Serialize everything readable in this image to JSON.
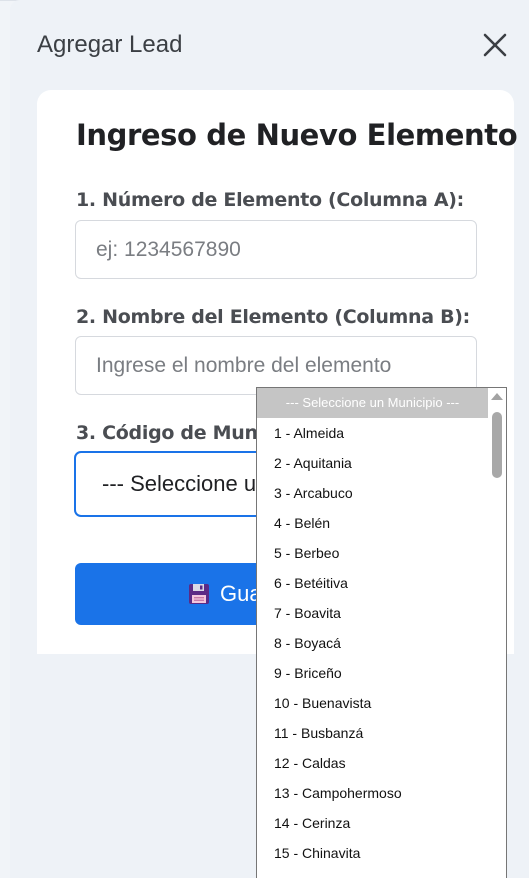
{
  "dialog": {
    "title": "Agregar Lead",
    "close_icon": "close-icon"
  },
  "form": {
    "heading": "Ingreso de Nuevo Elemento",
    "field1": {
      "label": "1. Número de Elemento (Columna A):",
      "placeholder": "ej: 1234567890",
      "value": ""
    },
    "field2": {
      "label": "2. Nombre del Elemento (Columna B):",
      "placeholder": "Ingrese el nombre del elemento",
      "value": ""
    },
    "field3": {
      "label": "3. Código de Munici",
      "selected": "--- Seleccione u"
    },
    "save": {
      "label": "Gua",
      "icon": "floppy-disk-icon"
    }
  },
  "dropdown": {
    "selected_option": "--- Seleccione un Municipio ---",
    "options": [
      "1 - Almeida",
      "2 - Aquitania",
      "3 - Arcabuco",
      "4 - Belén",
      "5 - Berbeo",
      "6 - Betéitiva",
      "7 - Boavita",
      "8 - Boyacá",
      "9 - Briceño",
      "10 - Buenavista",
      "11 - Busbanzá",
      "12 - Caldas",
      "13 - Campohermoso",
      "14 - Cerinza",
      "15 - Chinavita"
    ]
  },
  "colors": {
    "accent": "#1a73e8",
    "selected_option_bg": "#c5c5c5"
  }
}
